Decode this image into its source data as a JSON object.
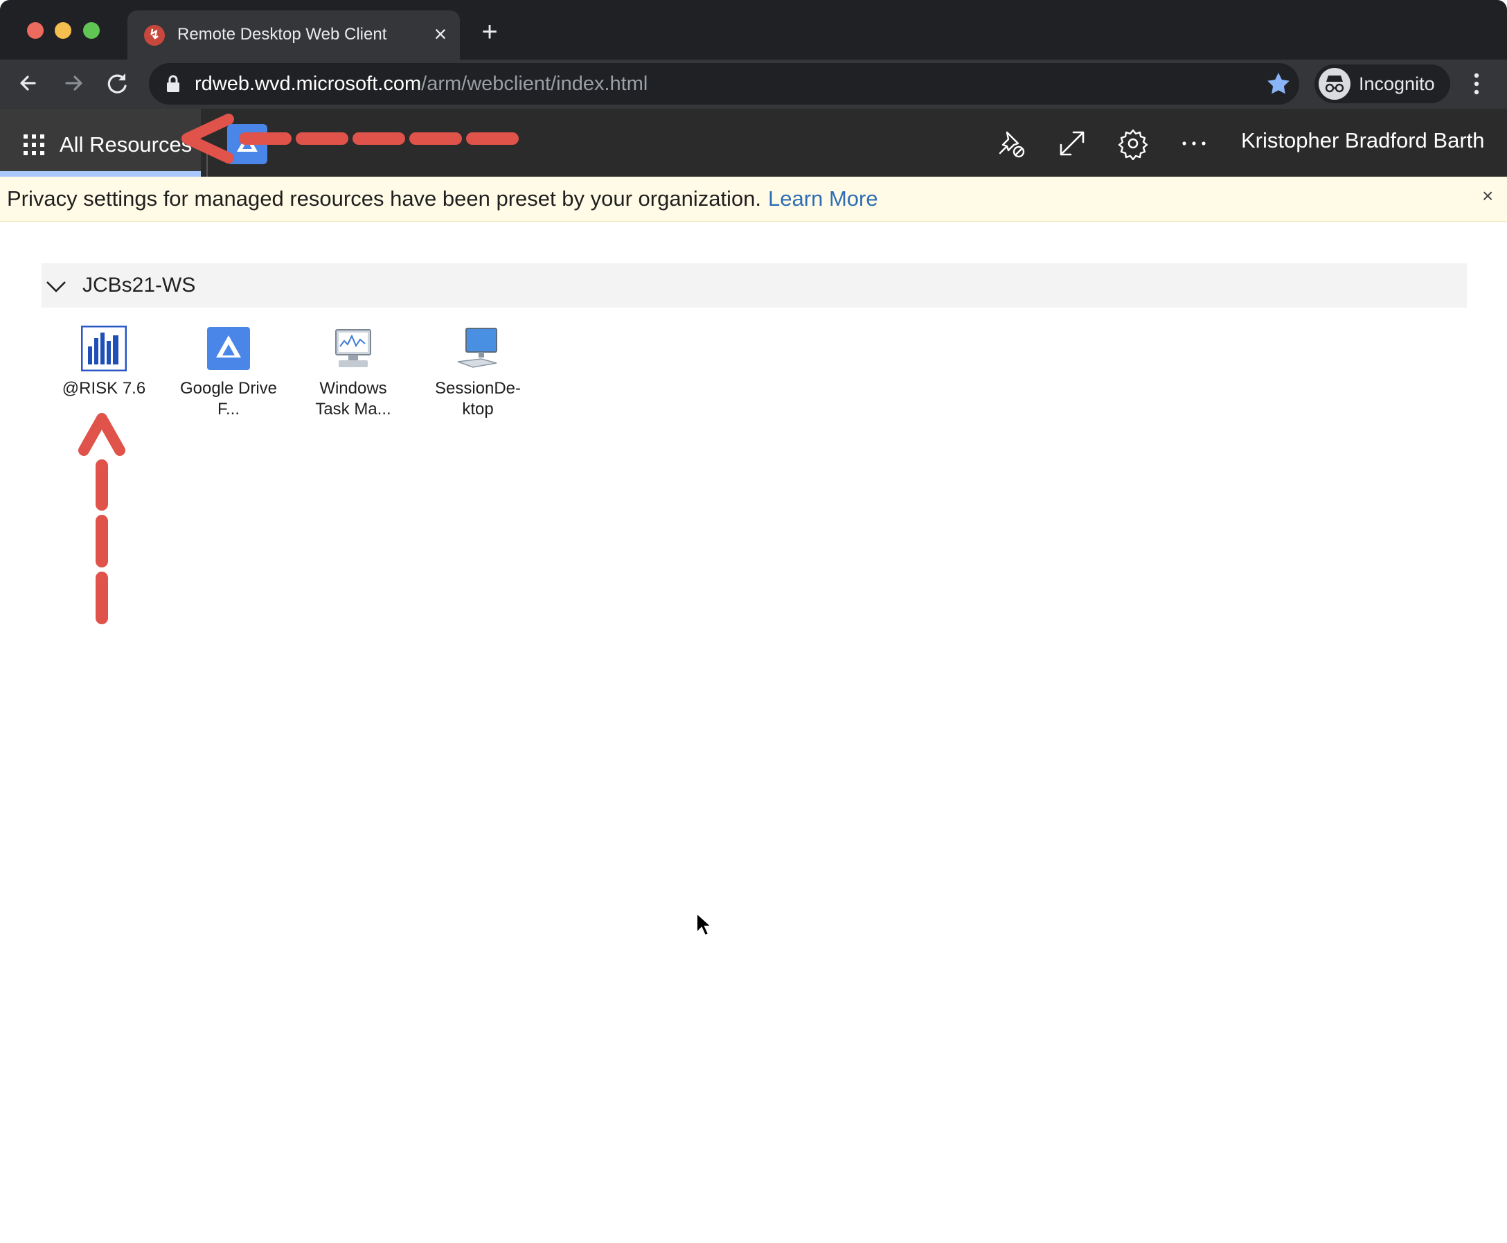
{
  "browser": {
    "tab": {
      "title": "Remote Desktop Web Client",
      "favicon": "remote-desktop-icon"
    },
    "url": {
      "host": "rdweb.wvd.microsoft.com",
      "path": "/arm/webclient/index.html"
    },
    "profile_label": "Incognito"
  },
  "appbar": {
    "all_resources_label": "All Resources",
    "user_name": "Kristopher Bradford Barth",
    "icons": [
      "pin-icon",
      "fullscreen-icon",
      "settings-icon",
      "more-icon"
    ]
  },
  "banner": {
    "message": "Privacy settings for managed resources have been preset by your organization.",
    "link": "Learn More",
    "close": "×"
  },
  "group": {
    "title": "JCBs21-WS",
    "resources": [
      {
        "line1": "@RISK 7.6",
        "line2": "",
        "icon": "risk-app-icon"
      },
      {
        "line1": "Google Drive",
        "line2": "F...",
        "icon": "google-drive-icon"
      },
      {
        "line1": "Windows",
        "line2": "Task Ma...",
        "icon": "task-manager-icon"
      },
      {
        "line1": "SessionDe-",
        "line2": "ktop",
        "icon": "desktop-icon"
      }
    ]
  },
  "colors": {
    "annotation_arrow": "#e0534a",
    "link": "#2f6eb5",
    "banner_bg": "#fffbe6",
    "chrome_dark": "#202124"
  }
}
